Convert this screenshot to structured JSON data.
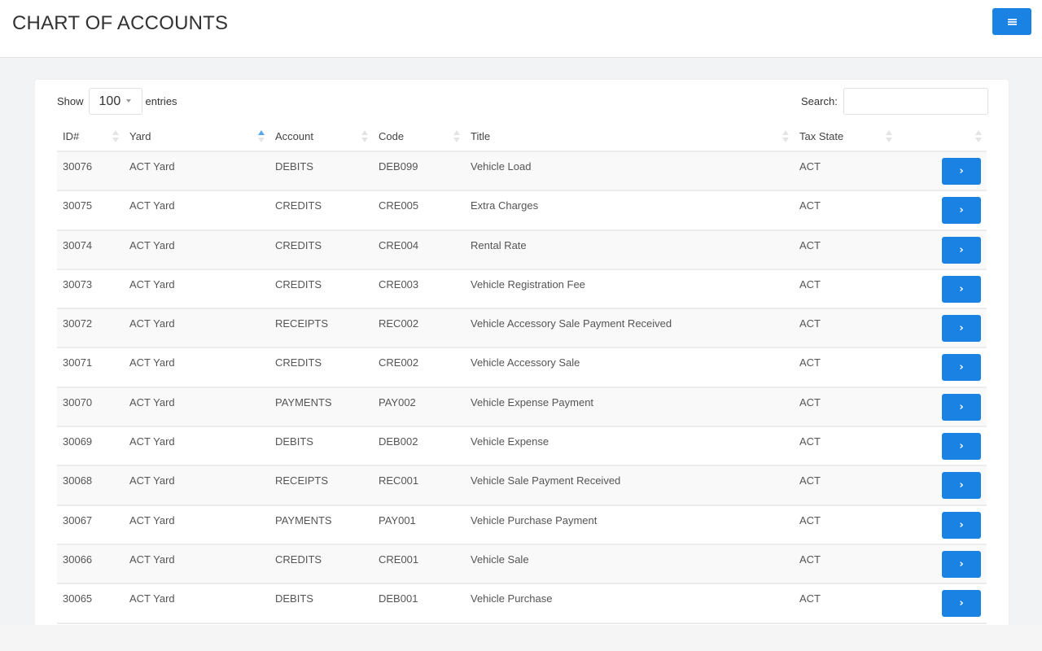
{
  "header": {
    "title": "CHART OF ACCOUNTS",
    "menu_icon": "hamburger-menu-icon"
  },
  "colors": {
    "accent": "#1a82e2",
    "sort_active": "#5aa6ee",
    "page_bg": "#f2f3f5"
  },
  "controls": {
    "show_label": "Show",
    "entries_label": "entries",
    "page_length": "100",
    "search_label": "Search:",
    "search_value": ""
  },
  "table": {
    "columns": [
      {
        "label": "ID#",
        "sort": "none"
      },
      {
        "label": "Yard",
        "sort": "asc"
      },
      {
        "label": "Account",
        "sort": "none"
      },
      {
        "label": "Code",
        "sort": "none"
      },
      {
        "label": "Title",
        "sort": "none"
      },
      {
        "label": "Tax State",
        "sort": "none"
      },
      {
        "label": "",
        "sort": "none"
      }
    ],
    "action_label": "›",
    "rows": [
      {
        "id": "30076",
        "yard": "ACT Yard",
        "account": "DEBITS",
        "code": "DEB099",
        "title": "Vehicle Load",
        "tax_state": "ACT"
      },
      {
        "id": "30075",
        "yard": "ACT Yard",
        "account": "CREDITS",
        "code": "CRE005",
        "title": "Extra Charges",
        "tax_state": "ACT"
      },
      {
        "id": "30074",
        "yard": "ACT Yard",
        "account": "CREDITS",
        "code": "CRE004",
        "title": "Rental Rate",
        "tax_state": "ACT"
      },
      {
        "id": "30073",
        "yard": "ACT Yard",
        "account": "CREDITS",
        "code": "CRE003",
        "title": "Vehicle Registration Fee",
        "tax_state": "ACT"
      },
      {
        "id": "30072",
        "yard": "ACT Yard",
        "account": "RECEIPTS",
        "code": "REC002",
        "title": "Vehicle Accessory Sale Payment Received",
        "tax_state": "ACT"
      },
      {
        "id": "30071",
        "yard": "ACT Yard",
        "account": "CREDITS",
        "code": "CRE002",
        "title": "Vehicle Accessory Sale",
        "tax_state": "ACT"
      },
      {
        "id": "30070",
        "yard": "ACT Yard",
        "account": "PAYMENTS",
        "code": "PAY002",
        "title": "Vehicle Expense Payment",
        "tax_state": "ACT"
      },
      {
        "id": "30069",
        "yard": "ACT Yard",
        "account": "DEBITS",
        "code": "DEB002",
        "title": "Vehicle Expense",
        "tax_state": "ACT"
      },
      {
        "id": "30068",
        "yard": "ACT Yard",
        "account": "RECEIPTS",
        "code": "REC001",
        "title": "Vehicle Sale Payment Received",
        "tax_state": "ACT"
      },
      {
        "id": "30067",
        "yard": "ACT Yard",
        "account": "PAYMENTS",
        "code": "PAY001",
        "title": "Vehicle Purchase Payment",
        "tax_state": "ACT"
      },
      {
        "id": "30066",
        "yard": "ACT Yard",
        "account": "CREDITS",
        "code": "CRE001",
        "title": "Vehicle Sale",
        "tax_state": "ACT"
      },
      {
        "id": "30065",
        "yard": "ACT Yard",
        "account": "DEBITS",
        "code": "DEB001",
        "title": "Vehicle Purchase",
        "tax_state": "ACT"
      }
    ]
  }
}
